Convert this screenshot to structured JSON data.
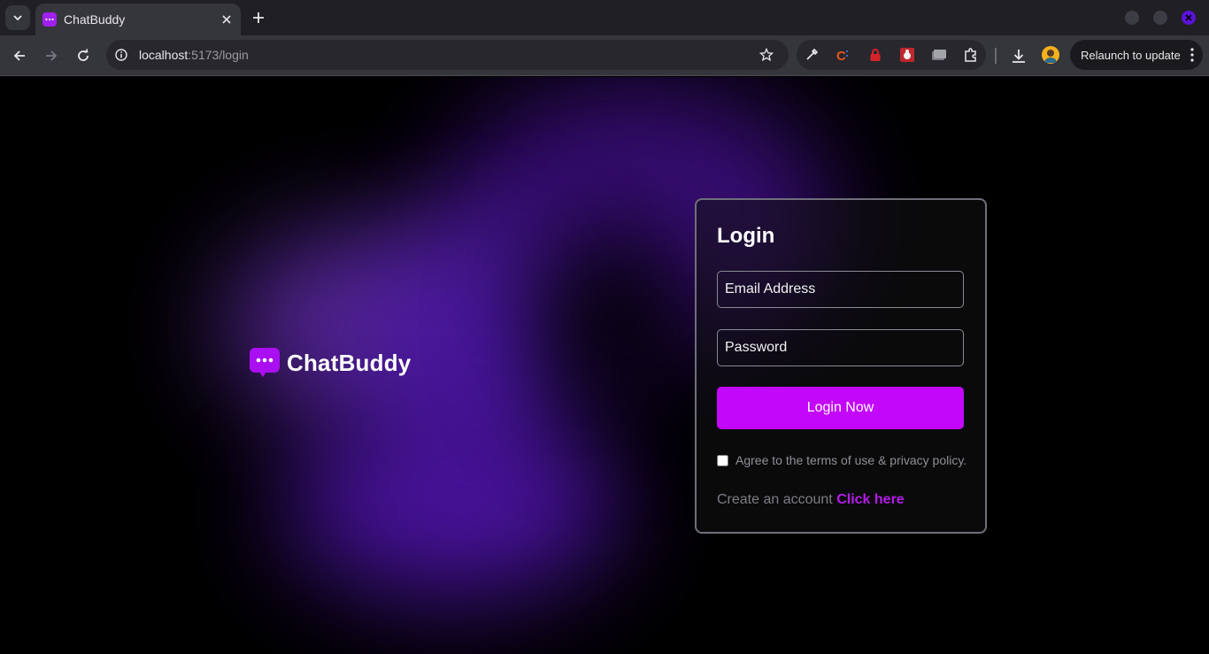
{
  "browser": {
    "tab_title": "ChatBuddy",
    "url_host": "localhost",
    "url_path": ":5173/login",
    "relaunch_label": "Relaunch to update"
  },
  "brand": {
    "name": "ChatBuddy"
  },
  "login_card": {
    "title": "Login",
    "email_placeholder": "Email Address",
    "password_placeholder": "Password",
    "submit_label": "Login Now",
    "terms_label": "Agree to the terms of use & privacy policy.",
    "create_prefix": "Create an account",
    "create_link": "Click here"
  },
  "colors": {
    "accent": "#c207fa",
    "link": "#b41be8",
    "glow": "#5a12b8"
  }
}
